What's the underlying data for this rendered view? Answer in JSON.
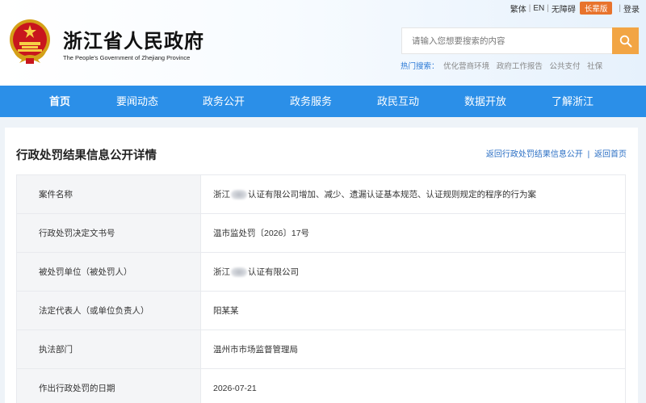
{
  "header": {
    "title": "浙江省人民政府",
    "subtitle": "The People's Government of Zhejiang Province",
    "top_links": [
      "繁体",
      "EN",
      "无障碍"
    ],
    "elder_mode": "长辈版",
    "login": "登录",
    "search": {
      "placeholder": "请输入您想要搜索的内容"
    },
    "hot_search": {
      "label": "热门搜索：",
      "items": [
        "优化营商环境",
        "政府工作报告",
        "公共支付",
        "社保"
      ]
    }
  },
  "nav": {
    "items": [
      "首页",
      "要闻动态",
      "政务公开",
      "政务服务",
      "政民互动",
      "数据开放",
      "了解浙江"
    ],
    "active": "首页"
  },
  "panel": {
    "title": "行政处罚结果信息公开详情",
    "links": [
      "返回行政处罚结果信息公开",
      "返回首页"
    ]
  },
  "details": {
    "case_name_label": "案件名称",
    "case_name_prefix": "浙江",
    "case_name_suffix": "认证有限公司增加、减少、遗漏认证基本规范、认证规则规定的程序的行为案",
    "decision_no_label": "行政处罚决定文书号",
    "decision_no": "温市监处罚〔2026〕17号",
    "party_label": "被处罚单位（被处罚人）",
    "party_prefix": "浙江",
    "party_suffix": "认证有限公司",
    "legal_rep_label": "法定代表人（或单位负责人）",
    "legal_rep": "阳某某",
    "dept_label": "执法部门",
    "dept": "温州市市场监督管理局",
    "date_label": "作出行政处罚的日期",
    "date": "2026-07-21"
  },
  "colors": {
    "nav_bg": "#2b8fe8",
    "search_btn": "#f2a544",
    "elder_btn": "#e8732c",
    "link": "#2b6fc4"
  }
}
